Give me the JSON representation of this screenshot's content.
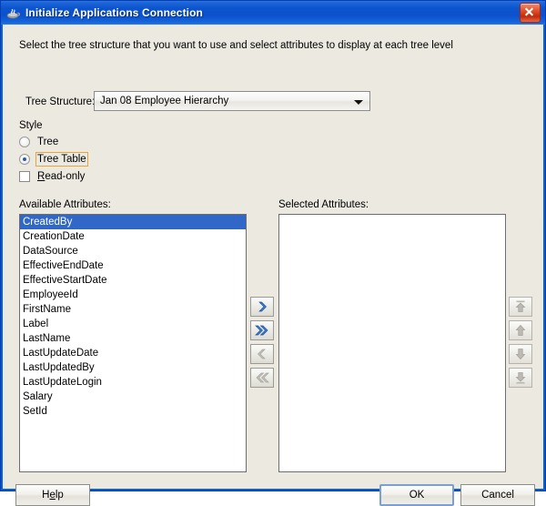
{
  "window": {
    "title": "Initialize Applications Connection",
    "icon": "java-coffee-cup-icon",
    "close_label": "close-icon"
  },
  "instruction": "Select the tree structure that you want to use and select attributes to display at each tree level",
  "tree_structure": {
    "label": "Tree Structure:",
    "value": "Jan 08 Employee Hierarchy",
    "arrow_icon": "chevron-down-icon"
  },
  "style": {
    "group_label": "Style",
    "options": [
      {
        "label": "Tree",
        "checked": false,
        "focused": false
      },
      {
        "label": "Tree Table",
        "checked": true,
        "focused": true
      }
    ],
    "readonly": {
      "label": "Read-only",
      "mnemonic": "R",
      "rest": "ead-only",
      "checked": false
    }
  },
  "available": {
    "caption": "Available Attributes:",
    "items": [
      "CreatedBy",
      "CreationDate",
      "DataSource",
      "EffectiveEndDate",
      "EffectiveStartDate",
      "EmployeeId",
      "FirstName",
      "Label",
      "LastName",
      "LastUpdateDate",
      "LastUpdatedBy",
      "LastUpdateLogin",
      "Salary",
      "SetId"
    ],
    "selected_index": 0
  },
  "selected": {
    "caption": "Selected Attributes:",
    "items": []
  },
  "transfer_buttons": [
    {
      "name": "move-right-icon",
      "enabled": true
    },
    {
      "name": "move-all-right-icon",
      "enabled": true
    },
    {
      "name": "move-left-icon",
      "enabled": false
    },
    {
      "name": "move-all-left-icon",
      "enabled": false
    }
  ],
  "reorder_buttons": [
    {
      "name": "move-to-top-icon",
      "enabled": false
    },
    {
      "name": "move-up-icon",
      "enabled": false
    },
    {
      "name": "move-down-icon",
      "enabled": false
    },
    {
      "name": "move-to-bottom-icon",
      "enabled": false
    }
  ],
  "footer": {
    "help_mnemonic_pre": "H",
    "help_mnemonic": "e",
    "help_mnemonic_post": "lp",
    "help_label": "Help",
    "ok_label": "OK",
    "cancel_label": "Cancel"
  },
  "colors": {
    "titlebar_blue": "#0b55cf",
    "selection_blue": "#3167c6",
    "focus_orange": "#e8a33d",
    "default_button_blue": "#7a9fd4",
    "dialog_bg": "#ece9e1",
    "close_red": "#c5290b"
  }
}
